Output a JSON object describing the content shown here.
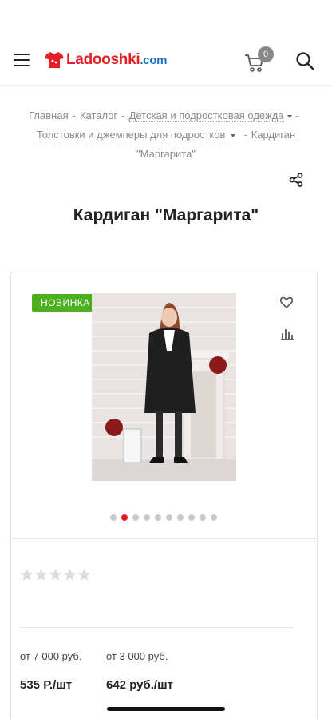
{
  "header": {
    "logo_main": "Ladooshki",
    "logo_suffix": ".com",
    "cart_count": "0",
    "colors": {
      "brand_red": "#e31e24",
      "brand_blue": "#1a73c9"
    }
  },
  "breadcrumb": {
    "items": [
      "Главная",
      "Каталог",
      "Детская и подростковая одежда",
      "Толстовки и джемперы для подростков",
      "Кардиган \"Маргарита\""
    ],
    "separator": "-"
  },
  "product": {
    "title": "Кардиган \"Маргарита\"",
    "badge": "НОВИНКА",
    "badge_color": "#4caf1e",
    "image_alt_icon": "product-photo",
    "gallery_total": 10,
    "gallery_active": 2,
    "rating": 0,
    "rating_max": 5,
    "prices": [
      {
        "tier": "от 7 000 руб.",
        "price": "535 Р./шт"
      },
      {
        "tier": "от 3 000 руб.",
        "price": "642 руб./шт"
      }
    ]
  },
  "icons": {
    "menu": "hamburger-icon",
    "cart": "cart-icon",
    "search": "search-icon",
    "share": "share-icon",
    "favorite": "heart-icon",
    "compare": "compare-icon",
    "star": "star-icon"
  }
}
